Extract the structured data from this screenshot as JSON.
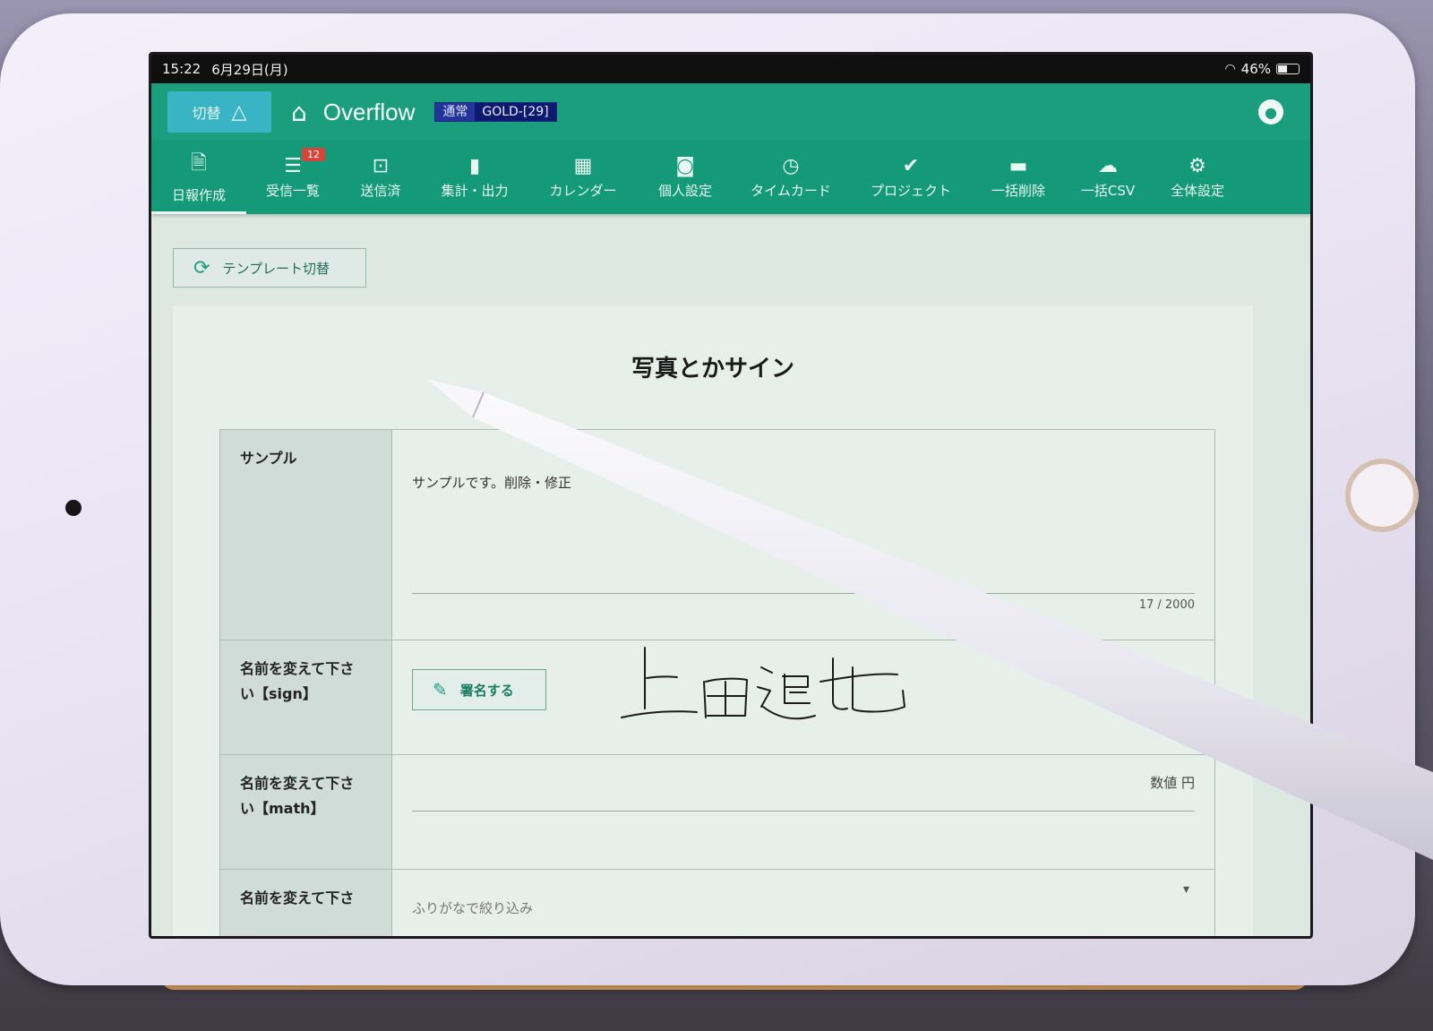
{
  "status_bar": {
    "time": "15:22",
    "date": "6月29日(月)",
    "battery": "46%"
  },
  "header": {
    "switch_label": "切替",
    "app_title": "Overflow",
    "plan_type": "通常",
    "plan_name": "GOLD-[29]"
  },
  "toolbar": {
    "items": [
      {
        "label": "日報作成",
        "icon": "new-report-icon",
        "glyph": "🗎"
      },
      {
        "label": "受信一覧",
        "icon": "list-icon",
        "glyph": "☰",
        "badge": "12"
      },
      {
        "label": "送信済",
        "icon": "outbox-icon",
        "glyph": "⊡"
      },
      {
        "label": "集計・出力",
        "icon": "bar-chart-icon",
        "glyph": "▮"
      },
      {
        "label": "カレンダー",
        "icon": "calendar-icon",
        "glyph": "▦"
      },
      {
        "label": "個人設定",
        "icon": "person-card-icon",
        "glyph": "◙"
      },
      {
        "label": "タイムカード",
        "icon": "timer-icon",
        "glyph": "◷"
      },
      {
        "label": "プロジェクト",
        "icon": "check-icon",
        "glyph": "✔"
      },
      {
        "label": "一括削除",
        "icon": "trash-icon",
        "glyph": "▬"
      },
      {
        "label": "一括CSV",
        "icon": "cloud-download-icon",
        "glyph": "☁"
      },
      {
        "label": "全体設定",
        "icon": "gear-icon",
        "glyph": "⚙"
      }
    ],
    "active_index": 0
  },
  "template_switch_label": "テンプレート切替",
  "form": {
    "title": "写真とかサイン",
    "sample": {
      "label": "サンプル",
      "value": "サンプルです。削除・修正",
      "char_count": "17 / 2000"
    },
    "sign": {
      "label_line1": "名前を変えて下さ",
      "label_line2": "い【sign】",
      "button_label": "署名する"
    },
    "math": {
      "label_line1": "名前を変えて下さ",
      "label_line2": "い【math】",
      "unit_label": "数値 円"
    },
    "furigana": {
      "label_line1": "名前を変えて下さ",
      "placeholder": "ふりがなで絞り込み"
    }
  }
}
